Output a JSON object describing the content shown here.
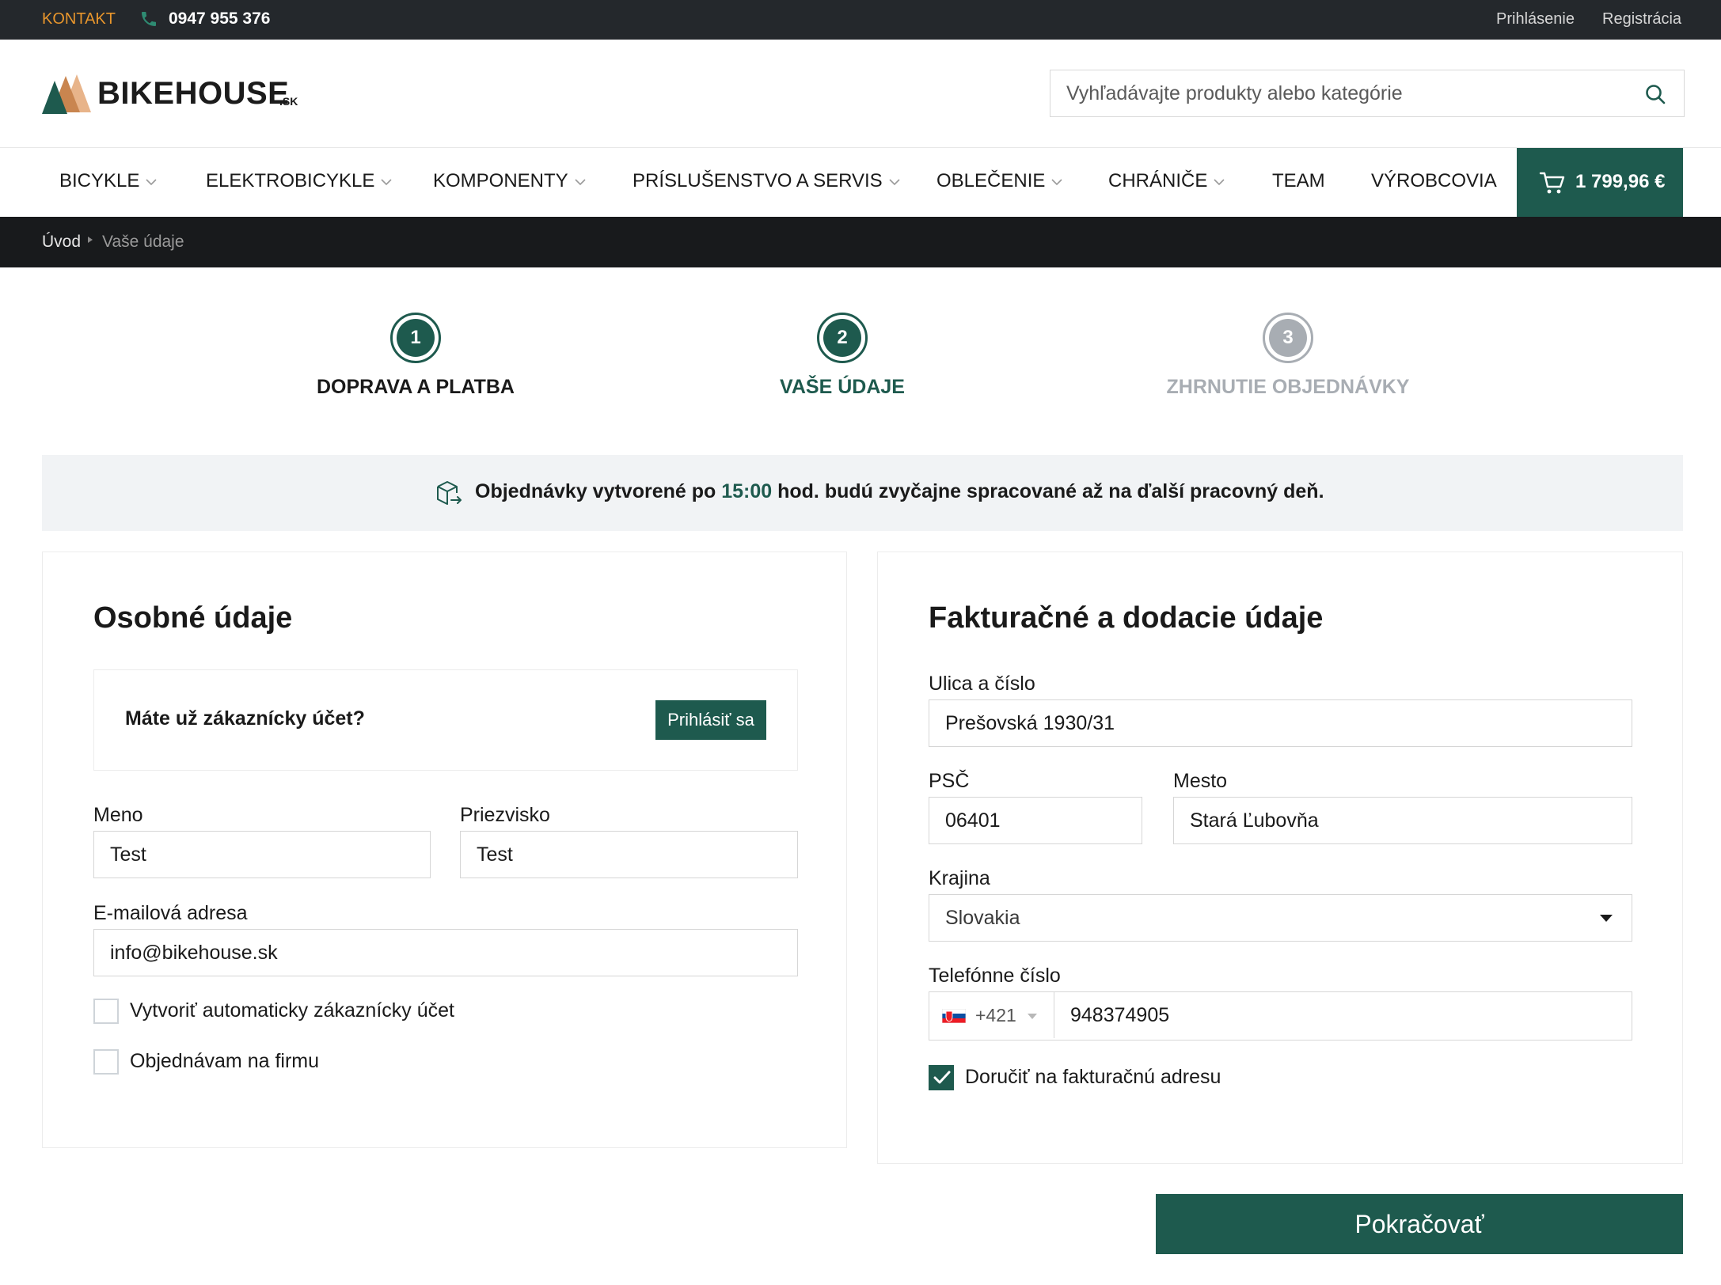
{
  "topbar": {
    "contact_label": "KONTAKT",
    "phone": "0947 955 376",
    "login": "Prihlásenie",
    "register": "Registrácia"
  },
  "header": {
    "logo_text": "BIKEHOUSE",
    "logo_tld": ".SK",
    "search_placeholder": "Vyhľadávajte produkty alebo kategórie"
  },
  "nav": {
    "items": [
      {
        "label": "BICYKLE",
        "dropdown": true
      },
      {
        "label": "ELEKTROBICYKLE",
        "dropdown": true
      },
      {
        "label": "KOMPONENTY",
        "dropdown": true
      },
      {
        "label": "PRÍSLUŠENSTVO A SERVIS",
        "dropdown": true
      },
      {
        "label": "OBLEČENIE",
        "dropdown": true
      },
      {
        "label": "CHRÁNIČE",
        "dropdown": true
      },
      {
        "label": "TEAM",
        "dropdown": false
      },
      {
        "label": "VÝROBCOVIA",
        "dropdown": false
      }
    ],
    "cart_total": "1 799,96 €"
  },
  "breadcrumb": {
    "home": "Úvod",
    "current": "Vaše údaje"
  },
  "steps": [
    {
      "number": "1",
      "label": "DOPRAVA A PLATBA",
      "state": "done"
    },
    {
      "number": "2",
      "label": "VAŠE ÚDAJE",
      "state": "active"
    },
    {
      "number": "3",
      "label": "ZHRNUTIE OBJEDNÁVKY",
      "state": "pending"
    }
  ],
  "notice": {
    "before": "Objednávky vytvorené po ",
    "time": "15:00",
    "after": " hod. budú zvyčajne spracované až na ďalší pracovný deň."
  },
  "personal": {
    "title": "Osobné údaje",
    "account_question": "Máte už zákaznícky účet?",
    "login_button": "Prihlásiť sa",
    "first_name_label": "Meno",
    "first_name_value": "Test",
    "last_name_label": "Priezvisko",
    "last_name_value": "Test",
    "email_label": "E-mailová adresa",
    "email_value": "info@bikehouse.sk",
    "create_account_label": "Vytvoriť automaticky zákaznícky účet",
    "create_account_checked": false,
    "company_label": "Objednávam na firmu",
    "company_checked": false
  },
  "billing": {
    "title": "Fakturačné a dodacie údaje",
    "street_label": "Ulica a číslo",
    "street_value": "Prešovská 1930/31",
    "zip_label": "PSČ",
    "zip_value": "06401",
    "city_label": "Mesto",
    "city_value": "Stará Ľubovňa",
    "country_label": "Krajina",
    "country_value": "Slovakia",
    "phone_label": "Telefónne číslo",
    "phone_prefix": "+421",
    "phone_value": "948374905",
    "deliver_label": "Doručiť na fakturačnú adresu",
    "deliver_checked": true
  },
  "continue_button": "Pokračovať",
  "colors": {
    "brand_green": "#1e5a4e",
    "topbar_bg": "#24282c",
    "contact_orange": "#e8962c",
    "pending_gray": "#a8adb3",
    "notice_bg": "#f1f3f5"
  }
}
